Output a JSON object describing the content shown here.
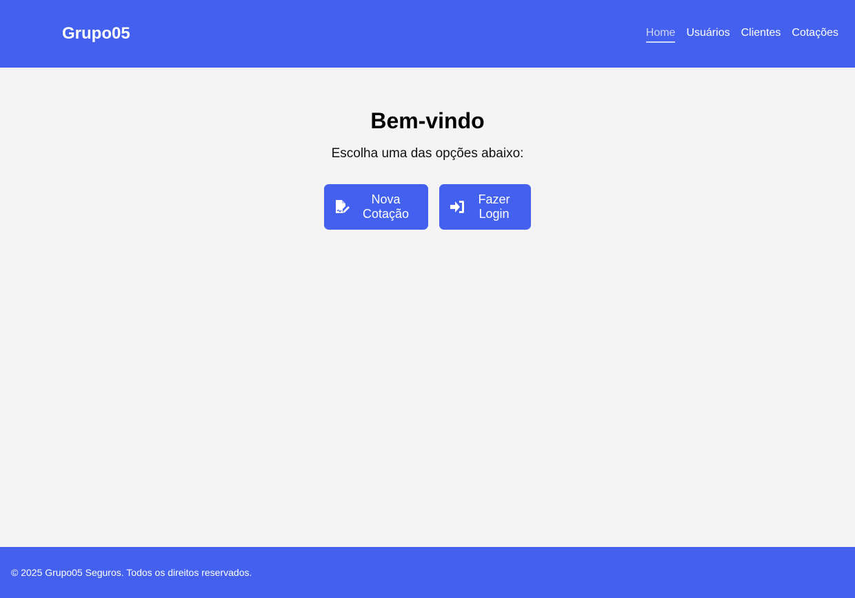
{
  "header": {
    "brand": "Grupo05",
    "nav": [
      {
        "label": "Home",
        "active": true
      },
      {
        "label": "Usuários",
        "active": false
      },
      {
        "label": "Clientes",
        "active": false
      },
      {
        "label": "Cotações",
        "active": false
      }
    ]
  },
  "main": {
    "title": "Bem-vindo",
    "subtitle": "Escolha uma das opções abaixo:",
    "buttons": [
      {
        "icon": "file-signature-icon",
        "line1": "Nova",
        "line2": "Cotação"
      },
      {
        "icon": "sign-in-icon",
        "line1": "Fazer",
        "line2": "Login"
      }
    ]
  },
  "footer": {
    "text": "© 2025 Grupo05 Seguros. Todos os direitos reservados."
  },
  "colors": {
    "primary": "#4361ee",
    "background": "#f4f4f4",
    "active_link": "#cfd6fb"
  }
}
